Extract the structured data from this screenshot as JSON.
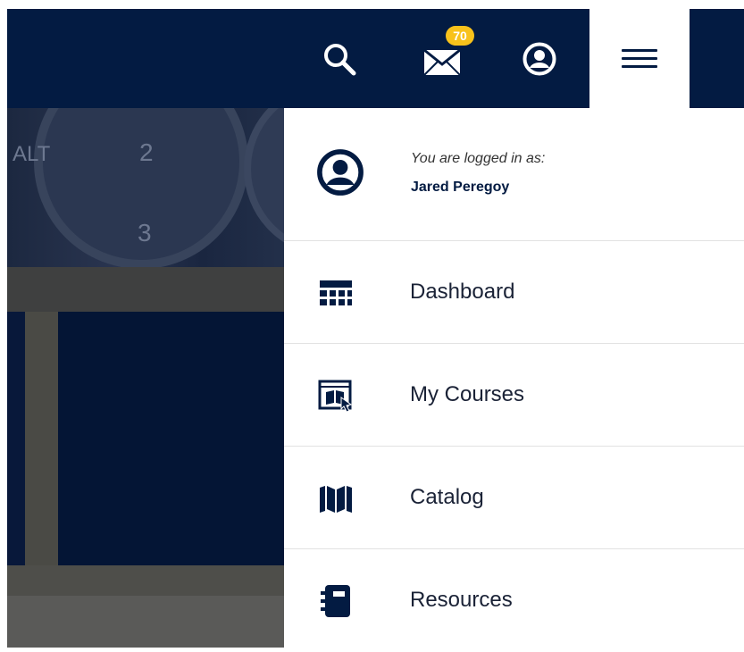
{
  "header": {
    "search_icon": "search-icon",
    "messages_icon": "envelope-icon",
    "messages_count": "70",
    "account_icon": "user-circle-icon",
    "menu_icon": "hamburger-icon",
    "bar_color": "#031b42",
    "badge_color": "#f8c21b"
  },
  "hero": {
    "gauge_labels": [
      "ALT",
      "2",
      "3"
    ]
  },
  "dropdown": {
    "user": {
      "caption": "You are logged in as:",
      "name": "Jared Peregoy",
      "icon": "user-circle-icon"
    },
    "items": [
      {
        "label": "Dashboard",
        "icon": "dashboard-grid-icon"
      },
      {
        "label": "My Courses",
        "icon": "course-window-icon"
      },
      {
        "label": "Catalog",
        "icon": "book-open-icon"
      },
      {
        "label": "Resources",
        "icon": "notebook-icon"
      }
    ]
  }
}
